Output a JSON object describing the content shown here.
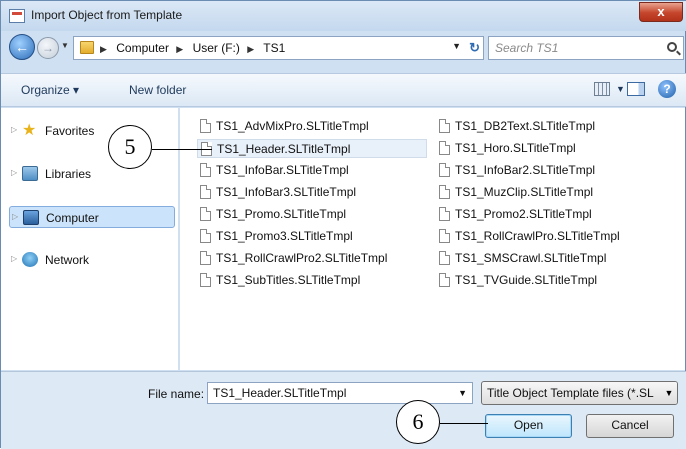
{
  "window": {
    "title": "Import Object from Template",
    "close_label": "x"
  },
  "nav": {
    "back_icon": "back-arrow-icon",
    "forward_icon": "forward-arrow-icon",
    "breadcrumbs": [
      "Computer",
      "User (F:)",
      "TS1"
    ],
    "search_placeholder": "Search TS1"
  },
  "toolbar": {
    "organize_label": "Organize ▾",
    "new_folder_label": "New folder",
    "help_label": "?"
  },
  "navpane": {
    "items": [
      {
        "label": "Favorites",
        "icon": "star-icon"
      },
      {
        "label": "Libraries",
        "icon": "libraries-icon"
      },
      {
        "label": "Computer",
        "icon": "computer-icon",
        "selected": true
      },
      {
        "label": "Network",
        "icon": "network-icon"
      }
    ]
  },
  "files": {
    "col1": [
      "TS1_AdvMixPro.SLTitleTmpl",
      "TS1_Header.SLTitleTmpl",
      "TS1_InfoBar.SLTitleTmpl",
      "TS1_InfoBar3.SLTitleTmpl",
      "TS1_Promo.SLTitleTmpl",
      "TS1_Promo3.SLTitleTmpl",
      "TS1_RollCrawlPro2.SLTitleTmpl",
      "TS1_SubTitles.SLTitleTmpl"
    ],
    "col2": [
      "TS1_DB2Text.SLTitleTmpl",
      "TS1_Horo.SLTitleTmpl",
      "TS1_InfoBar2.SLTitleTmpl",
      "TS1_MuzClip.SLTitleTmpl",
      "TS1_Promo2.SLTitleTmpl",
      "TS1_RollCrawlPro.SLTitleTmpl",
      "TS1_SMSCrawl.SLTitleTmpl",
      "TS1_TVGuide.SLTitleTmpl"
    ],
    "selected": "TS1_Header.SLTitleTmpl"
  },
  "bottom": {
    "filename_label": "File name:",
    "filename_value": "TS1_Header.SLTitleTmpl",
    "filetype_value": "Title Object Template files (*.SL",
    "open_label": "Open",
    "cancel_label": "Cancel"
  },
  "callouts": {
    "c5": "5",
    "c6": "6"
  }
}
